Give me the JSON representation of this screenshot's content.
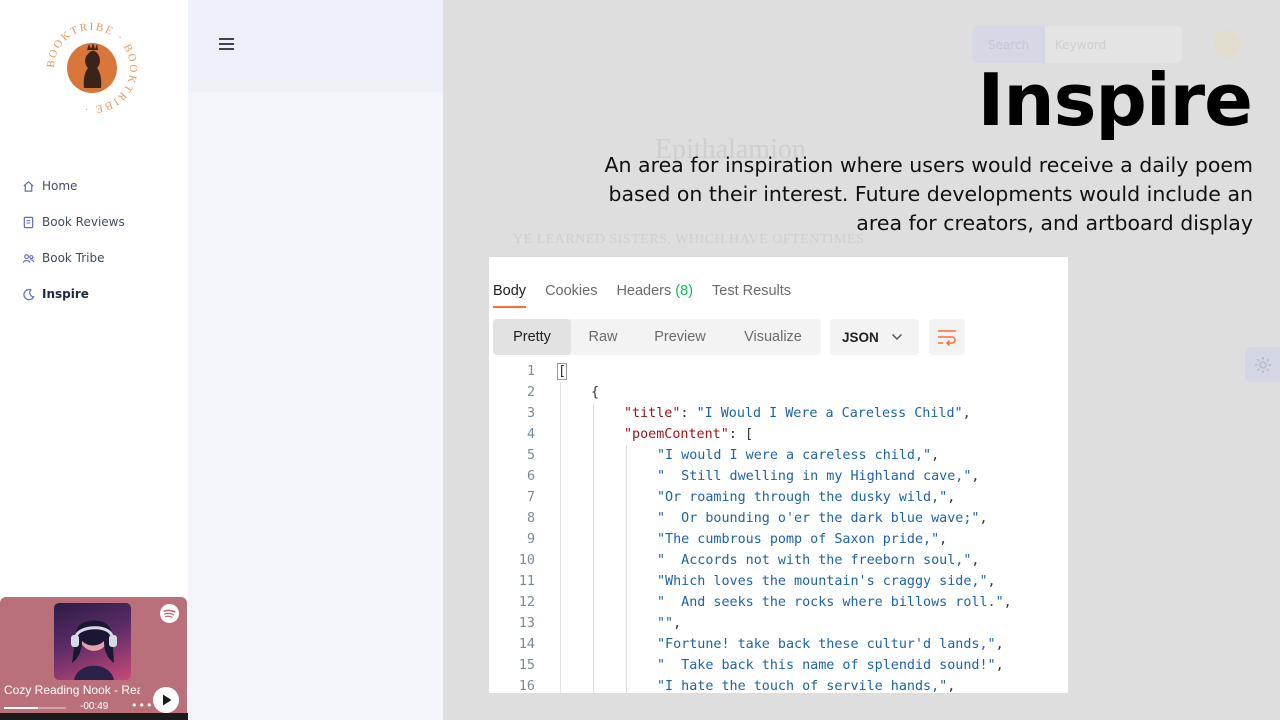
{
  "sidebar": {
    "logo_text": "BOOKTRIBE · BOOKTRIBE ·",
    "items": [
      {
        "label": "Home",
        "icon": "home-icon"
      },
      {
        "label": "Book Reviews",
        "icon": "book-icon"
      },
      {
        "label": "Book Tribe",
        "icon": "users-icon"
      },
      {
        "label": "Inspire",
        "icon": "moon-icon"
      }
    ],
    "active": "Inspire"
  },
  "player": {
    "track_title": "Cozy Reading Nook - Rea",
    "time_left": "-00:49",
    "more": "•••",
    "progress_fraction": 0.55
  },
  "header": {
    "search_button": "Search",
    "search_placeholder": "Keyword"
  },
  "background_page": {
    "heading": "Epithalamion",
    "first_line": "YE LEARNED SISTERS, WHICH HAVE OFTENTIMES"
  },
  "slide": {
    "title": "Inspire",
    "description": "An area for inspiration where users would receive a daily poem based on their interest. Future developments would include an area for creators, and artboard display"
  },
  "response_panel": {
    "tabs": [
      {
        "label": "Body",
        "count": ""
      },
      {
        "label": "Cookies",
        "count": ""
      },
      {
        "label": "Headers",
        "count": "(8)"
      },
      {
        "label": "Test Results",
        "count": ""
      }
    ],
    "views": [
      "Pretty",
      "Raw",
      "Preview",
      "Visualize"
    ],
    "active_view": "Pretty",
    "format": "JSON",
    "lines": [
      {
        "n": "1",
        "key": "",
        "val": "",
        "raw": "["
      },
      {
        "n": "2",
        "key": "",
        "val": "",
        "raw": "{"
      },
      {
        "n": "3",
        "key": "\"title\"",
        "val": "\"I Would I Were a Careless Child\"",
        "raw": ","
      },
      {
        "n": "4",
        "key": "\"poemContent\"",
        "val": "",
        "raw": "["
      },
      {
        "n": "5",
        "key": "",
        "val": "\"I would I were a careless child,\"",
        "raw": ","
      },
      {
        "n": "6",
        "key": "",
        "val": "\"  Still dwelling in my Highland cave,\"",
        "raw": ","
      },
      {
        "n": "7",
        "key": "",
        "val": "\"Or roaming through the dusky wild,\"",
        "raw": ","
      },
      {
        "n": "8",
        "key": "",
        "val": "\"  Or bounding o'er the dark blue wave;\"",
        "raw": ","
      },
      {
        "n": "9",
        "key": "",
        "val": "\"The cumbrous pomp of Saxon pride,\"",
        "raw": ","
      },
      {
        "n": "10",
        "key": "",
        "val": "\"  Accords not with the freeborn soul,\"",
        "raw": ","
      },
      {
        "n": "11",
        "key": "",
        "val": "\"Which loves the mountain's craggy side,\"",
        "raw": ","
      },
      {
        "n": "12",
        "key": "",
        "val": "\"  And seeks the rocks where billows roll.\"",
        "raw": ","
      },
      {
        "n": "13",
        "key": "",
        "val": "\"\"",
        "raw": ","
      },
      {
        "n": "14",
        "key": "",
        "val": "\"Fortune! take back these cultur'd lands,\"",
        "raw": ","
      },
      {
        "n": "15",
        "key": "",
        "val": "\"  Take back this name of splendid sound!\"",
        "raw": ","
      },
      {
        "n": "16",
        "key": "",
        "val": "\"I hate the touch of servile hands,\"",
        "raw": ","
      }
    ]
  },
  "colors": {
    "accent_orange": "#ff6c37",
    "json_key": "#a31515",
    "json_string": "#1d63a8",
    "player_bg": "#b9707b",
    "logo_orange": "#d9773a"
  }
}
